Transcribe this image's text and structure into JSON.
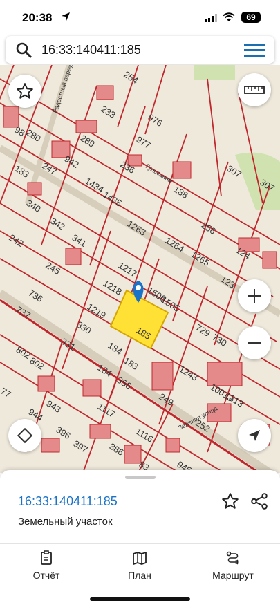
{
  "status": {
    "time": "20:38",
    "battery": "69"
  },
  "search": {
    "query": "16:33:140411:185"
  },
  "map": {
    "street1": "Радостный переулок",
    "street2": "Гульсанам",
    "street3": "Зеленая улица",
    "plots": [
      "254",
      "233",
      "976",
      "98",
      "280",
      "289",
      "977",
      "247",
      "942",
      "236",
      "183",
      "1434",
      "188",
      "307",
      "1435",
      "340",
      "307",
      "342",
      "1263",
      "256",
      "242",
      "341",
      "1264",
      "124",
      "245",
      "1217",
      "1265",
      "123",
      "736",
      "1218",
      "1506",
      "1505",
      "737",
      "1219",
      "729",
      "330",
      "185",
      "730",
      "802",
      "331",
      "184",
      "183",
      "802",
      "184",
      "356",
      "1243",
      "77",
      "943",
      "249",
      "1313",
      "10013",
      "944",
      "1117",
      "396",
      "252",
      "1116",
      "397",
      "386",
      "945",
      "83"
    ]
  },
  "colors": {
    "parcel_border": "#c0272d",
    "building": "#e58a8a",
    "selected": "#ffe135",
    "accent": "#1a73c8",
    "pin": "#1a73c8"
  },
  "sheet": {
    "cadastral": "16:33:140411:185",
    "type": "Земельный участок"
  },
  "tabs": [
    {
      "label": "Отчёт",
      "icon": "report-icon"
    },
    {
      "label": "План",
      "icon": "map-icon"
    },
    {
      "label": "Маршрут",
      "icon": "route-icon"
    }
  ]
}
